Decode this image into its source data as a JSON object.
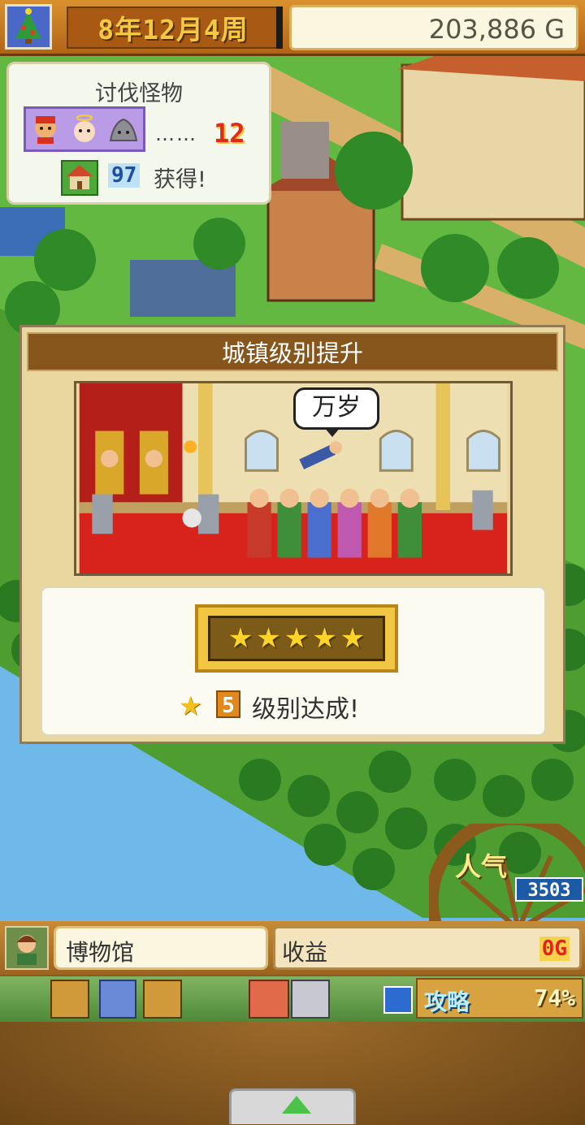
{
  "top_bar": {
    "date": "8年12月4周",
    "gold": "203,886 G"
  },
  "quest": {
    "title": "讨伐怪物",
    "dots": "……",
    "count": "12",
    "reward_amount": "97",
    "reward_text": "获得!"
  },
  "level_up": {
    "title": "城镇级别提升",
    "speech": "万岁",
    "star_count": 5,
    "star_glyph": "★",
    "rank_number": "5",
    "rank_text": "级别达成!"
  },
  "popularity": {
    "label": "人气",
    "value": "3503"
  },
  "bottom": {
    "facility_name": "博物馆",
    "income_label": "收益",
    "income_value": "0G",
    "strategy_label": "攻略",
    "strategy_value": "74%"
  },
  "colors": {
    "grass": "#5cae3a",
    "water": "#6fb8ea",
    "accent_gold": "#f0c642",
    "header_brown": "#86561d"
  }
}
